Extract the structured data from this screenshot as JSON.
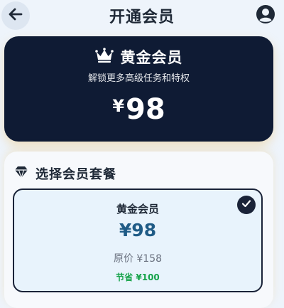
{
  "header": {
    "title": "开通会员"
  },
  "hero": {
    "title": "黄金会员",
    "subtitle": "解锁更多高级任务和特权",
    "currency": "¥",
    "amount": "98"
  },
  "plans": {
    "title": "选择会员套餐",
    "items": [
      {
        "name": "黄金会员",
        "price": "¥98",
        "original": "原价 ¥158",
        "saving": "节省 ¥100",
        "selected": true
      }
    ]
  },
  "icons": {
    "back": "arrow-left-icon",
    "profile": "user-circle-icon",
    "crown": "crown-icon",
    "gem": "gem-icon",
    "check": "check-icon"
  },
  "colors": {
    "hero_bg": "#0f1b34",
    "price_blue": "#1f5b86",
    "saving_green": "#16a34a",
    "card_bg": "#e8f3fc"
  }
}
